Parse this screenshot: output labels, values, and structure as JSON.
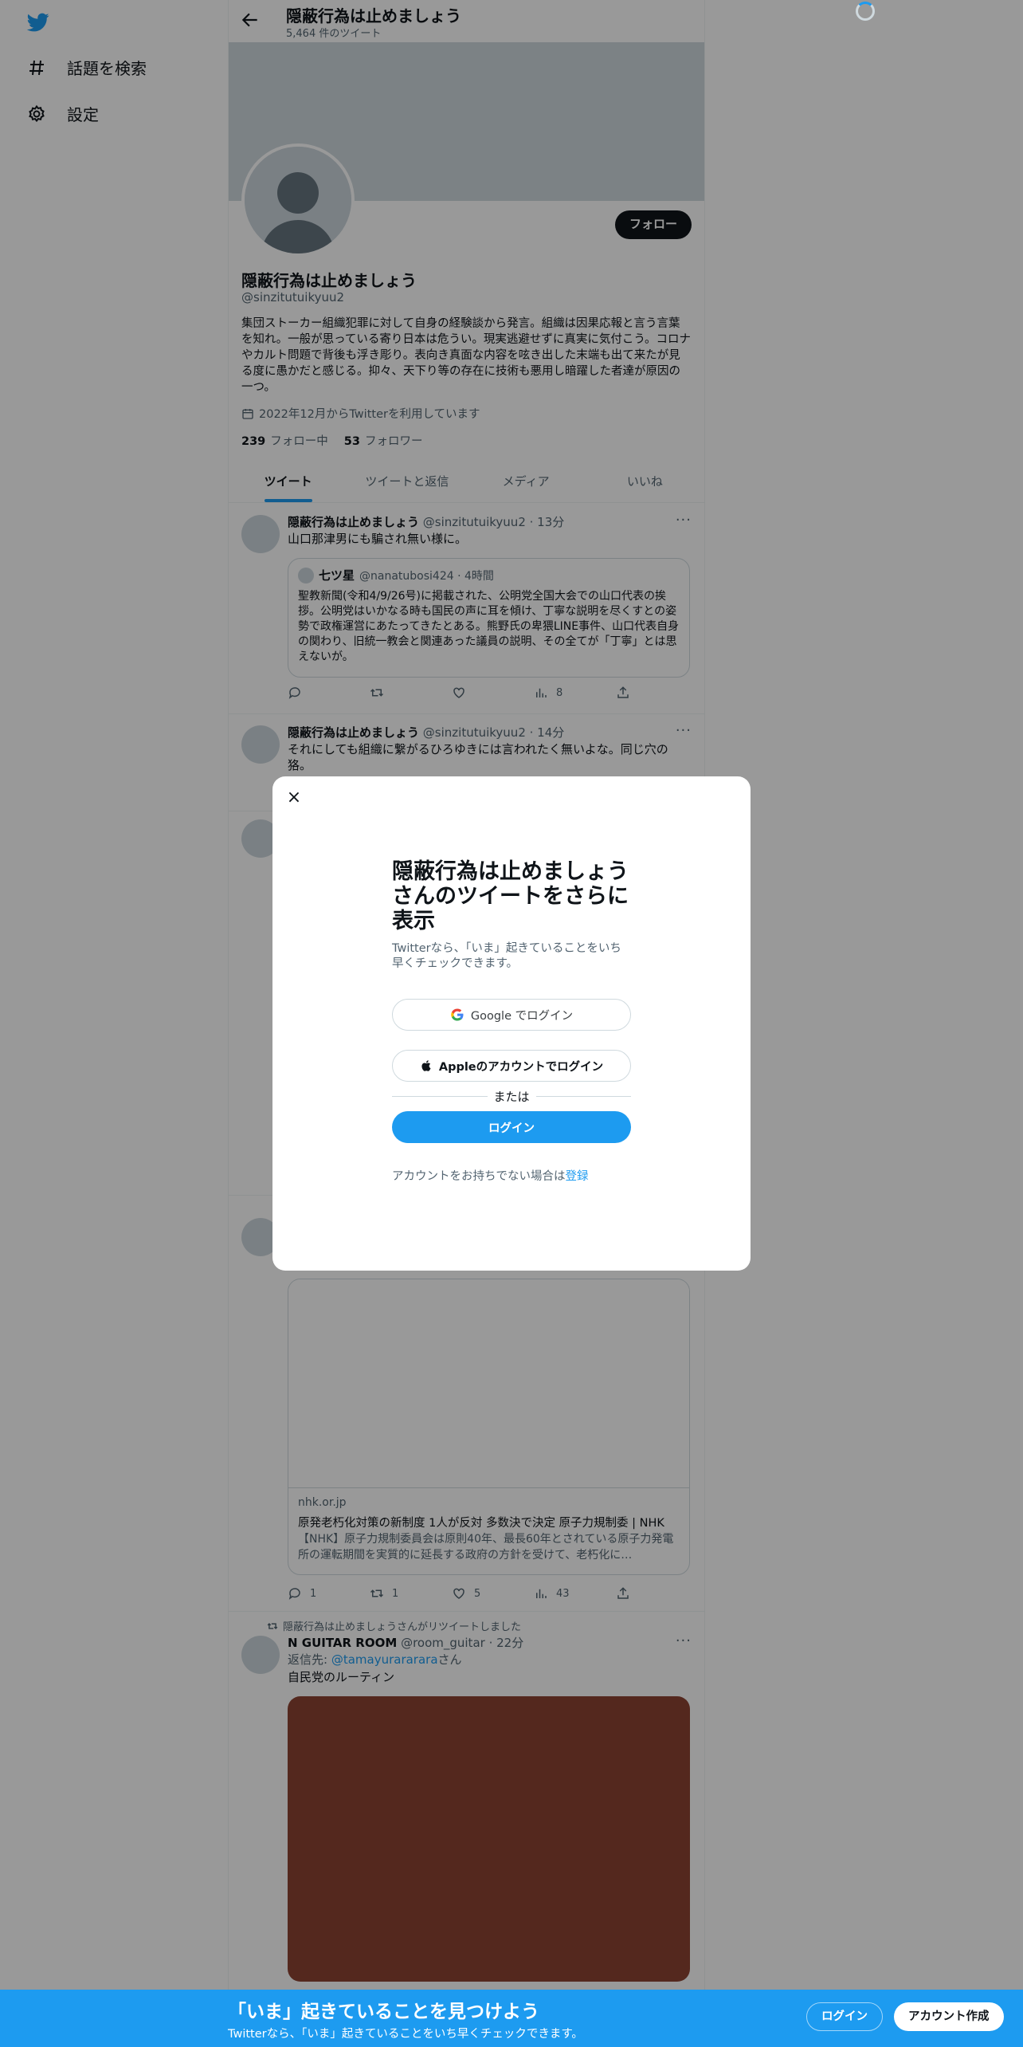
{
  "nav": {
    "items": [
      {
        "icon": "hashtag-icon",
        "label": "話題を検索"
      },
      {
        "icon": "gear-icon",
        "label": "設定"
      }
    ]
  },
  "header": {
    "title": "隠蔽行為は止めましょう",
    "tweet_count": "5,464 件のツイート"
  },
  "profile": {
    "follow_label": "フォロー",
    "name": "隠蔽行為は止めましょう",
    "handle": "@sinzitutuikyuu2",
    "bio": "集団ストーカー組織犯罪に対して自身の経験談から発言。組織は因果応報と言う言葉を知れ。一般が思っている寄り日本は危うい。現実逃避せずに真実に気付こう。コロナやカルト問題で背後も浮き彫り。表向き真面な内容を呟き出した末端も出て来たが見る度に愚かだと感じる。抑々、天下り等の存在に技術も悪用し暗躍した者達が原因の一つ。",
    "joined": "2022年12月からTwitterを利用しています",
    "following_count": "239",
    "following_label": "フォロー中",
    "followers_count": "53",
    "followers_label": "フォロワー"
  },
  "tabs": [
    "ツイート",
    "ツイートと返信",
    "メディア",
    "いいね"
  ],
  "tweets": [
    {
      "name": "隠蔽行為は止めましょう",
      "meta": "@sinzitutuikyuu2 · 13分",
      "text": "山口那津男にも騙され無い様に。",
      "quote": {
        "name": "七ツ星",
        "meta": "@nanatubosi424 · 4時間",
        "text": "聖教新聞(令和4/9/26号)に掲載された、公明党全国大会での山口代表の挨拶。公明党はいかなる時も国民の声に耳を傾け、丁寧な説明を尽くすとの姿勢で政権運営にあたってきたとある。熊野氏の卑猥LINE事件、山口代表自身の関わり、旧統一教会と関連あった議員の説明、その全てが「丁寧」とは思えないが。"
      },
      "views": "8"
    },
    {
      "name": "隠蔽行為は止めましょう",
      "meta": "@sinzitutuikyuu2 · 14分",
      "text": "それにしても組織に繋がるひろゆきには言われたく無いよな。同じ穴の狢。"
    },
    {
      "card_domain": "nhk.or.jp",
      "card_title": "原発老朽化対策の新制度 1人が反対 多数決で決定 原子力規制委 | NHK",
      "card_desc": "【NHK】原子力規制委員会は原則40年、最長60年とされている原子力発電所の運転期間を実質的に延長する政府の方針を受けて、老朽化に…",
      "replies": "1",
      "retweets": "1",
      "likes": "5",
      "views": "43"
    },
    {
      "retweeted_by": "隠蔽行為は止めましょうさんがリツイートしました",
      "name": "N GUITAR ROOM",
      "meta": "@room_guitar · 22分",
      "reply_prefix": "返信先: ",
      "reply_to": "@tamayurararara",
      "reply_suffix": "さん",
      "text": "自民党のルーティン"
    }
  ],
  "modal": {
    "close": "×",
    "title": "隠蔽行為は止めましょうさんのツイートをさらに表示",
    "subtitle": "Twitterなら、「いま」起きていることをいち早くチェックできます。",
    "google_label": "Google でログイン",
    "apple_label": "Appleのアカウントでログイン",
    "or_label": "または",
    "login_label": "ログイン",
    "no_account": "アカウントをお持ちでない場合は",
    "signup_link": "登録"
  },
  "bottom_bar": {
    "heading": "「いま」起きていることを見つけよう",
    "sub": "Twitterなら、「いま」起きていることをいち早くチェックできます。",
    "login": "ログイン",
    "signup": "アカウント作成"
  },
  "colors": {
    "accent": "#1d9bf0",
    "media": "#8c4332",
    "overlay": "rgba(0,0,0,0.4)"
  }
}
